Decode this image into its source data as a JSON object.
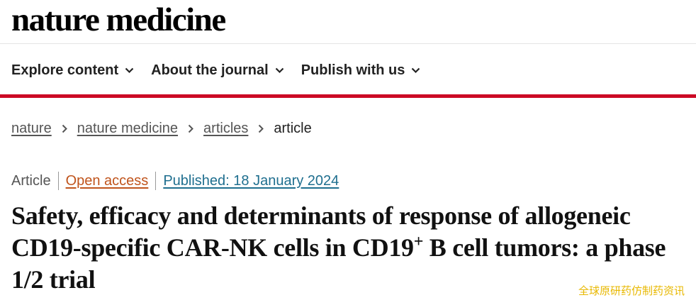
{
  "site": {
    "logo_text": "nature medicine"
  },
  "nav": {
    "items": [
      {
        "label": "Explore content",
        "icon": "chevron-down-icon"
      },
      {
        "label": "About the journal",
        "icon": "chevron-down-icon"
      },
      {
        "label": "Publish with us",
        "icon": "chevron-down-icon"
      }
    ]
  },
  "breadcrumb": {
    "items": [
      "nature",
      "nature medicine",
      "articles"
    ],
    "current": "article"
  },
  "article": {
    "type": "Article",
    "access": "Open access",
    "published": "Published: 18 January 2024",
    "title_part1": "Safety, efficacy and determinants of response of allogeneic CD19-specific CAR-NK cells in CD19",
    "title_sup": "+",
    "title_part2": " B cell tumors: a phase 1/2 trial"
  },
  "watermark": "全球原研药仿制药资讯",
  "colors": {
    "accent_red": "#cc0a25",
    "open_access": "#c0541c",
    "published_link": "#1f6f8f",
    "watermark": "#e8b800"
  }
}
